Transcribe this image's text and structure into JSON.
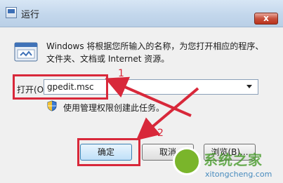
{
  "window": {
    "title": "运行",
    "close_label": "x"
  },
  "description": {
    "line1": "Windows 将根据您所输入的名称，为您打开相应的程序、",
    "line2": "文件夹、文档或 Internet 资源。"
  },
  "open_field": {
    "label": "打开(O):",
    "value": "gpedit.msc"
  },
  "admin_note": "使用管理权限创建此任务。",
  "buttons": {
    "ok": "确定",
    "cancel": "取消",
    "browse": "浏览(B)..."
  },
  "annotations": {
    "step1": "1",
    "step2": "2",
    "highlight_color": "#d8283a"
  },
  "watermark": {
    "text": "系统之家",
    "url": "xitongcheng.com"
  }
}
